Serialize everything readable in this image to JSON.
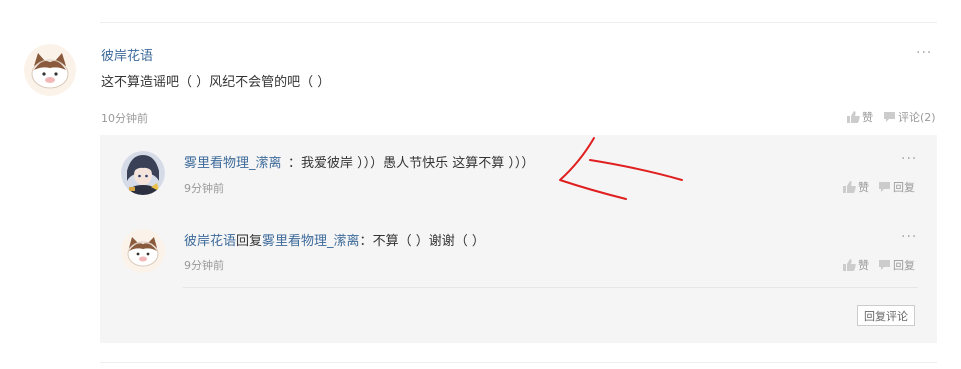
{
  "comment": {
    "author": "彼岸花语",
    "text": "这不算造谣吧（ ）风纪不会管的吧（ ）",
    "time": "10分钟前",
    "like_label": "赞",
    "comment_label": "评论(2)",
    "more": "···"
  },
  "replies": [
    {
      "author": "雾里看物理_潆离",
      "separator": "：",
      "text": "我爱彼岸 ）））愚人节快乐 这算不算 ）））",
      "time": "9分钟前",
      "like_label": "赞",
      "reply_label": "回复",
      "more": "···"
    },
    {
      "author": "彼岸花语",
      "reply_word": "回复",
      "reply_to": "雾里看物理_潆离",
      "separator": "：",
      "text": "不算（ ）谢谢（ ）",
      "time": "9分钟前",
      "like_label": "赞",
      "reply_label": "回复",
      "more": "···"
    }
  ],
  "reply_button_label": "回复评论",
  "colors": {
    "link": "#3d6a9a",
    "muted": "#999999",
    "reply_bg": "#f5f5f5",
    "annotation": "#e02020"
  }
}
